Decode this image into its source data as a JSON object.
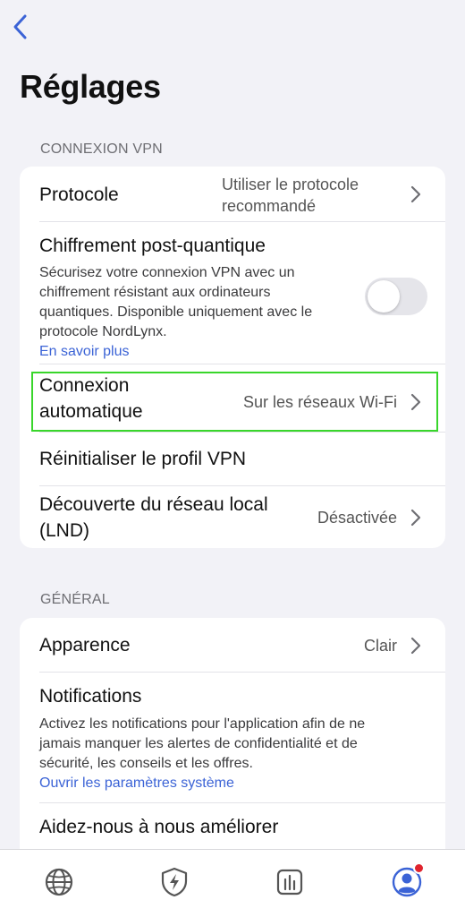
{
  "header": {
    "title": "Réglages"
  },
  "sections": {
    "vpn": {
      "header": "CONNEXION VPN",
      "protocol": {
        "label": "Protocole",
        "value_line1": "Utiliser le protocole",
        "value_line2": "recommandé"
      },
      "post_quantum": {
        "label": "Chiffrement post-quantique",
        "desc_line1": "Sécurisez votre connexion VPN avec un",
        "desc_line2": "chiffrement résistant aux ordinateurs",
        "desc_line3": "quantiques. Disponible uniquement avec le",
        "desc_line4": "protocole NordLynx.",
        "link": "En savoir plus",
        "enabled": false
      },
      "auto_connect": {
        "label_line1": "Connexion",
        "label_line2": "automatique",
        "value": "Sur les réseaux Wi-Fi"
      },
      "reset": {
        "label": "Réinitialiser le profil VPN"
      },
      "lnd": {
        "label_line1": "Découverte du réseau local",
        "label_line2": "(LND)",
        "value": "Désactivée"
      }
    },
    "general": {
      "header": "GÉNÉRAL",
      "appearance": {
        "label": "Apparence",
        "value": "Clair"
      },
      "notifications": {
        "label": "Notifications",
        "desc_line1": "Activez les notifications pour l'application afin de ne",
        "desc_line2": "jamais manquer les alertes de confidentialité et de",
        "desc_line3": "sécurité, les conseils et les offres.",
        "link": "Ouvrir les paramètres système"
      },
      "help": {
        "label": "Aidez-nous à nous améliorer"
      }
    }
  },
  "tabbar": {
    "tabs": [
      "globe-icon",
      "shield-bolt-icon",
      "stats-icon",
      "profile-icon"
    ],
    "accent_color": "#3b63d6",
    "badge_color": "#e0242e"
  },
  "colors": {
    "link": "#3b63d6",
    "highlight": "#39d62b"
  }
}
